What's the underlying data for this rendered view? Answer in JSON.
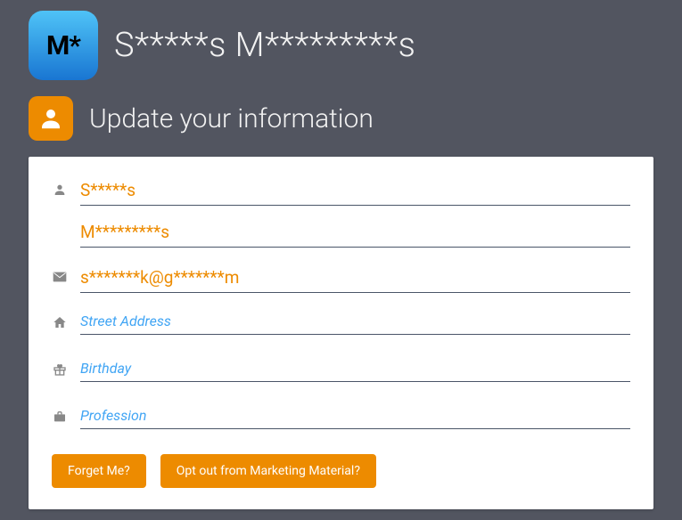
{
  "header": {
    "avatar_initials": "M*",
    "title": "S*****s M*********s"
  },
  "section": {
    "title": "Update your information"
  },
  "form": {
    "first_name": "S*****s",
    "last_name": "M*********s",
    "email": "s*******k@g*******m",
    "street_address": "",
    "street_address_placeholder": "Street Address",
    "birthday": "",
    "birthday_placeholder": "Birthday",
    "profession": "",
    "profession_placeholder": "Profession"
  },
  "buttons": {
    "forget_me": "Forget Me?",
    "opt_out": "Opt out from Marketing Material?"
  }
}
